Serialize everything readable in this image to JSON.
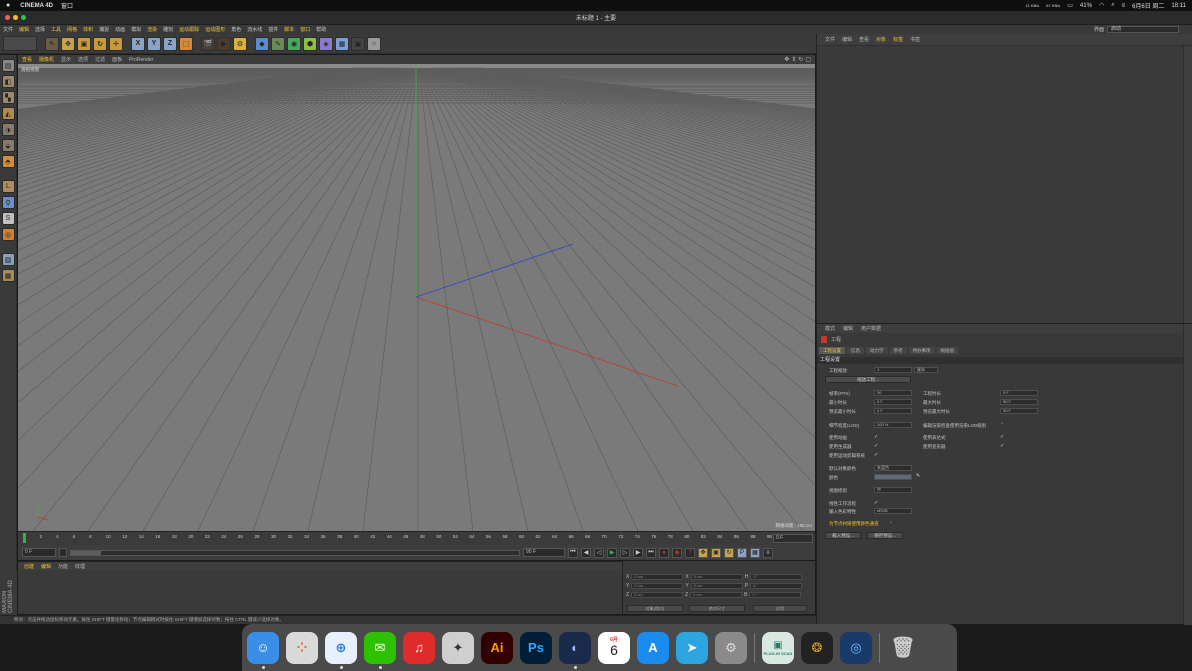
{
  "mac_menubar": {
    "app_name": "CINEMA 4D",
    "menu": "窗口",
    "net_up": "11 KB/s",
    "net_down": "67 KB/s",
    "battery": "41%",
    "date": "6月6日 周二",
    "time": "18:11"
  },
  "window": {
    "title": "未标题 1 - 主要"
  },
  "c4d_menu": {
    "items": [
      "文件",
      "编辑",
      "选择",
      "工具",
      "网格",
      "体积",
      "捕捉",
      "动画",
      "模拟",
      "渲染",
      "雕刻",
      "运动跟踪",
      "运动图形",
      "角色",
      "流水线",
      "插件",
      "脚本",
      "窗口",
      "帮助"
    ],
    "highlighted": [
      "编辑",
      "工具",
      "网格",
      "体积",
      "渲染",
      "运动跟踪",
      "运动图形",
      "脚本",
      "窗口"
    ],
    "layout_label": "界面",
    "layout_value": "启动"
  },
  "toolbar": {
    "axis_labels": [
      "X",
      "Y",
      "Z"
    ]
  },
  "viewport": {
    "menu": [
      "查看",
      "摄像机",
      "显示",
      "选项",
      "过滤",
      "面板",
      "ProRender"
    ],
    "camera_label": "透视视图",
    "grid_label": "网格间距 : 100 cm"
  },
  "timeline": {
    "ticks": [
      "0",
      "2",
      "4",
      "6",
      "8",
      "10",
      "12",
      "14",
      "16",
      "18",
      "20",
      "22",
      "24",
      "26",
      "28",
      "30",
      "32",
      "34",
      "36",
      "38",
      "40",
      "42",
      "44",
      "46",
      "48",
      "50",
      "52",
      "54",
      "56",
      "58",
      "60",
      "62",
      "64",
      "66",
      "68",
      "70",
      "72",
      "74",
      "76",
      "78",
      "80",
      "82",
      "84",
      "86",
      "88",
      "90"
    ],
    "end_frame": "0 F",
    "current_frame": "0 F",
    "start_field": "0 F",
    "end_field": "90 F",
    "end_field2": "90 F"
  },
  "material_manager": {
    "menu": [
      "创建",
      "编辑",
      "功能",
      "纹理"
    ]
  },
  "coords": {
    "rows": [
      {
        "a": "X",
        "av": "0 cm",
        "b": "X",
        "bv": "0 cm",
        "c": "H",
        "cv": "0 °"
      },
      {
        "a": "Y",
        "av": "0 cm",
        "b": "Y",
        "bv": "0 cm",
        "c": "P",
        "cv": "0 °"
      },
      {
        "a": "Z",
        "av": "0 cm",
        "b": "Z",
        "bv": "0 cm",
        "c": "B",
        "cv": "0 °"
      }
    ],
    "dropdown1": "对象(相对)",
    "dropdown2": "绝对尺寸",
    "apply": "应用"
  },
  "status_bar": "移动：点击并拖动鼠标移动元素。按住 SHIFT 键量化移动；节点编辑模式时按住 SHIFT 键增加选择对象；按住 CTRL 键减少选择对象。",
  "object_manager": {
    "menu": [
      "文件",
      "编辑",
      "查看",
      "对象",
      "标签",
      "书签"
    ],
    "highlighted": [
      "对象",
      "标签"
    ]
  },
  "attribute_manager": {
    "menu": [
      "模式",
      "编辑",
      "用户数据"
    ],
    "title": "工程",
    "tabs": [
      "工程设置",
      "信息",
      "动力学",
      "参考",
      "待办事项",
      "帧插值"
    ],
    "section": "工程设置",
    "scale_label": "工程缩放",
    "scale_value": "1",
    "scale_unit": "厘米",
    "scale_button": "缩放工程...",
    "fps_label": "帧率(FPS)",
    "fps_value": "30",
    "project_time_label": "工程时长",
    "project_time_value": "0 F",
    "min_time_label": "最小时长",
    "min_time_value": "0 F",
    "max_time_label": "最大时长",
    "max_time_value": "90 F",
    "prev_min_label": "预览最小时长",
    "prev_min_value": "0 F",
    "prev_max_label": "预览最大时长",
    "prev_max_value": "90 F",
    "lod_label": "细节程度(LOD)",
    "lod_value": "100 %",
    "lod_render_label": "编辑渲染检查使用渲染LOD级别",
    "use_anim_label": "使用动画",
    "use_expr_label": "使用表达式",
    "use_gen_label": "使用生成器",
    "use_deform_label": "使用变形器",
    "use_motion_label": "使用运动剪辑系统",
    "default_color_label": "默认对象颜色",
    "default_color_value": "灰蓝色",
    "color_label": "颜色",
    "view_clip_label": "视图修剪",
    "view_clip_value": "中",
    "linear_label": "线性工作流程",
    "input_color_label": "输入色彩特性",
    "input_color_value": "sRGB",
    "node_color_label": "为节点材质使用颜色通道",
    "load_preset": "载入预设...",
    "save_preset": "保存预设..."
  },
  "dock": {
    "calendar_month": "6月",
    "calendar_day": "6",
    "ai": "Ai",
    "ps": "Ps",
    "plugin_label": "PLUG-IN SCAN"
  },
  "colors": {
    "accent": "#f1c232",
    "y_axis": "#3cb043",
    "x_axis": "#c0392b",
    "z_axis": "#2f47c8"
  }
}
